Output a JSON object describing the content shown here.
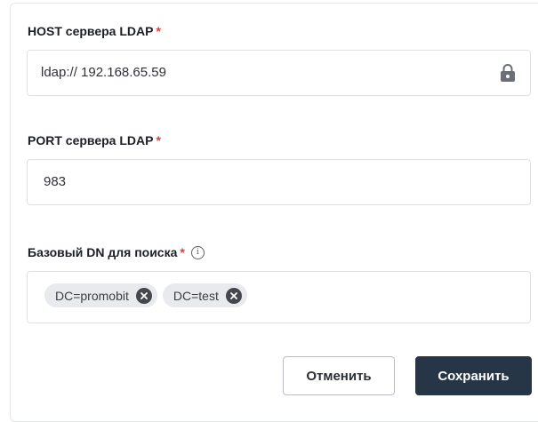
{
  "form": {
    "host": {
      "label": "HOST сервера LDAP",
      "required_mark": "*",
      "value": "ldap:// 192.168.65.59",
      "icon": "lock-icon"
    },
    "port": {
      "label": "PORT сервера LDAP",
      "required_mark": "*",
      "value": "983"
    },
    "base_dn": {
      "label": "Базовый DN для поиска",
      "required_mark": "*",
      "info_icon": "i",
      "tags": [
        {
          "text": "DC=promobit"
        },
        {
          "text": "DC=test"
        }
      ]
    }
  },
  "actions": {
    "cancel_label": "Отменить",
    "save_label": "Сохранить"
  },
  "colors": {
    "required": "#e0393e",
    "primary_button": "#263646",
    "chip_background": "#e8eaed"
  }
}
